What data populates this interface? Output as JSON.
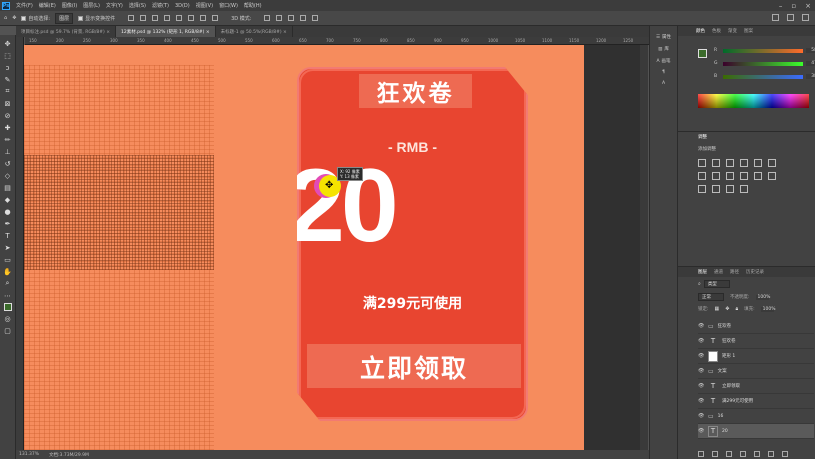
{
  "menubar": {
    "logo": "Ps",
    "items": [
      "文件(F)",
      "编辑(E)",
      "图像(I)",
      "图层(L)",
      "文字(Y)",
      "选择(S)",
      "滤镜(T)",
      "3D(D)",
      "视图(V)",
      "窗口(W)",
      "帮助(H)"
    ]
  },
  "options": {
    "auto_select_label": "自动选择:",
    "auto_select_value": "图层",
    "show_transform_label": "显示变换控件",
    "three_d_label": "3D 模式:"
  },
  "tabs": [
    {
      "label": "项目标注.psd @ 59.7% (背景, RGB/8#) ×"
    },
    {
      "label": "12素材.psd @ 132% (矩形 1, RGB/8#) ×"
    },
    {
      "label": "未标题-1 @ 50.5%(RGB/8#) ×"
    }
  ],
  "ruler": {
    "h_ticks": [
      "150",
      "200",
      "250",
      "300",
      "350",
      "400",
      "450",
      "500",
      "550",
      "600",
      "650",
      "700",
      "750",
      "800",
      "850",
      "900",
      "950",
      "1000",
      "1050",
      "1100",
      "1150",
      "1200",
      "1250"
    ]
  },
  "coupon": {
    "title": "狂欢卷",
    "currency": "- RMB -",
    "amount": "20",
    "condition": "满299元可使用",
    "claim_label": "立即领取"
  },
  "cursor_tip": {
    "dx": "X: 92 像素",
    "dy": "Y: 13 像素"
  },
  "status": {
    "zoom": "131.37%",
    "doc": "文档:3.73M/29.9M"
  },
  "panel_strip": {
    "items": [
      "属性",
      "库",
      "画笔"
    ]
  },
  "color_panel": {
    "tabs": [
      "颜色",
      "色板",
      "渐变",
      "图案"
    ],
    "r_label": "R",
    "g_label": "G",
    "b_label": "B",
    "r_value": "58",
    "g_value": "47",
    "b_value": "38",
    "fg_color": "#3b6b2b"
  },
  "adjust_panel": {
    "title": "调整",
    "subtitle": "添加调整"
  },
  "layers_panel": {
    "tabs": [
      "图层",
      "通道",
      "路径",
      "历史记录"
    ],
    "filter_label": "类型",
    "blend_mode": "正常",
    "opacity_label": "不透明度:",
    "opacity_value": "100%",
    "lock_label": "锁定:",
    "fill_label": "填充:",
    "fill_value": "100%",
    "layers": [
      {
        "name": "狂欢卷",
        "kind": "folder"
      },
      {
        "name": "狂欢卷",
        "kind": "text"
      },
      {
        "name": "矩形 1",
        "kind": "shape"
      },
      {
        "name": "文案",
        "kind": "folder"
      },
      {
        "name": "立即领取",
        "kind": "text"
      },
      {
        "name": "满299元可使用",
        "kind": "text"
      },
      {
        "name": "16",
        "kind": "folder"
      },
      {
        "name": "20",
        "kind": "text"
      }
    ]
  },
  "colors": {
    "canvas_bg": "#f68c5d",
    "coupon_red": "#e84530",
    "accent_orange": "#ee6a52"
  }
}
